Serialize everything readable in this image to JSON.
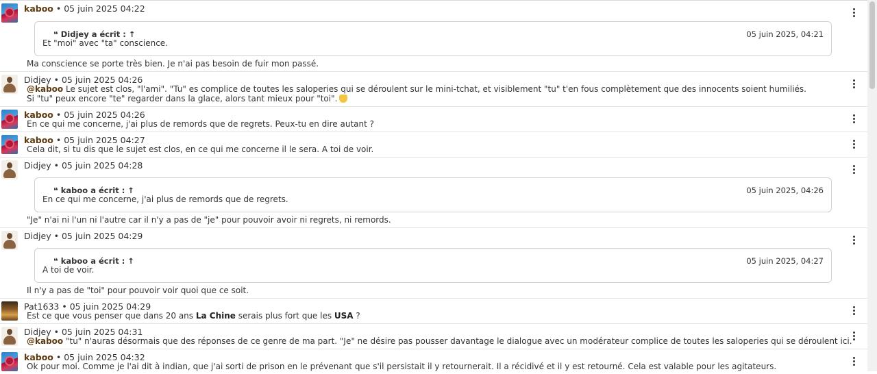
{
  "messages": [
    {
      "author": "kaboo",
      "author_bold": true,
      "date": "05 juin 2025 04:22",
      "quote": {
        "head": "Didjey a écrit : ↑",
        "date": "05 juin 2025, 04:21",
        "text": "Et \"moi\" avec \"ta\" conscience."
      },
      "line1": "Ma conscience se porte très bien. Je n'ai pas besoin de fuir mon passé."
    },
    {
      "author": "Didjey",
      "author_bold": false,
      "date": "05 juin 2025 04:26",
      "mention": "@kaboo",
      "line1": " Le sujet est clos, \"l'ami\". \"Tu\" es complice de toutes les saloperies qui se déroulent sur le mini-tchat, et visiblement \"tu\" t'en fous complètement que des innocents soient humiliés.",
      "line2": "Si \"tu\" peux encore \"te\" regarder dans la glace, alors tant mieux pour \"toi\"."
    },
    {
      "author": "kaboo",
      "author_bold": true,
      "date": "05 juin 2025 04:26",
      "line1": "En ce qui me concerne, j'ai plus de remords que de regrets. Peux-tu en dire autant ?"
    },
    {
      "author": "kaboo",
      "author_bold": true,
      "date": "05 juin 2025 04:27",
      "line1": "Cela dit, si tu dis que le sujet est clos, en ce qui me concerne il le sera. A toi de voir."
    },
    {
      "author": "Didjey",
      "author_bold": false,
      "date": "05 juin 2025 04:28",
      "quote": {
        "head": "kaboo a écrit : ↑",
        "date": "05 juin 2025, 04:26",
        "text": "En ce qui me concerne, j'ai plus de remords que de regrets."
      },
      "line1": "\"Je\" n'ai ni l'un ni l'autre car il n'y a pas de \"je\" pour pouvoir avoir ni regrets, ni remords."
    },
    {
      "author": "Didjey",
      "author_bold": false,
      "date": "05 juin 2025 04:29",
      "quote": {
        "head": "kaboo a écrit : ↑",
        "date": "05 juin 2025, 04:27",
        "text": "A toi de voir."
      },
      "line1": "Il n'y a pas de \"toi\" pour pouvoir voir quoi que ce soit."
    },
    {
      "author": "Pat1633",
      "author_bold": false,
      "date": "05 juin 2025 04:29",
      "pat": {
        "a": "Est ce que vous penser que dans 20 ans ",
        "b": "La Chine",
        "c": " serais plus fort que les ",
        "d": "USA",
        "e": " ?"
      }
    },
    {
      "author": "Didjey",
      "author_bold": false,
      "date": "05 juin 2025 04:31",
      "mention": "@kaboo",
      "line1": " \"tu\" n'auras désormais que des réponses de ce genre de ma part. \"Je\" ne désire pas pousser davantage le dialogue avec un modérateur complice de toutes les saloperies qui se déroulent ici."
    },
    {
      "author": "kaboo",
      "author_bold": true,
      "date": "05 juin 2025 04:32",
      "line1": "Ok pour moi. Comme je l'ai dit à indian, que j'ai sorti de prison en le prévenant que s'il persistait il y retournerait. Il a récidivé et il y est retourné. Cela est valable pour les agitateurs."
    }
  ],
  "separator": "•",
  "quote_icon": "quote-icon",
  "menu_icon": "kebab-menu-icon",
  "emoji_icon": "thumbs-up-emoji",
  "colors": {
    "author": "#5c3a0f",
    "border": "#d0d0d0"
  }
}
